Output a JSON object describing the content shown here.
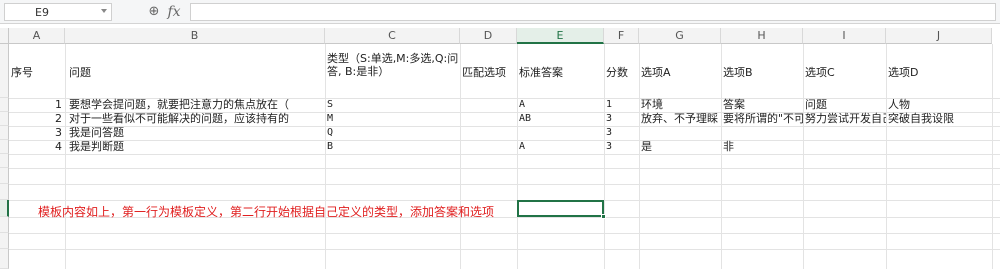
{
  "formula_bar": {
    "cell_ref": "E9",
    "fx_label": "fx",
    "formula_value": ""
  },
  "columns": [
    "A",
    "B",
    "C",
    "D",
    "E",
    "F",
    "G",
    "H",
    "I",
    "J"
  ],
  "selected_column": "E",
  "header_row": {
    "seq": "序号",
    "question": "问题",
    "type": "类型（S:单选,M:多选,Q:问答, B:是非）",
    "match": "匹配选项",
    "answer": "标准答案",
    "score": "分数",
    "optA": "选项A",
    "optB": "选项B",
    "optC": "选项C",
    "optD": "选项D"
  },
  "rows": [
    {
      "seq": "1",
      "question": "要想学会提问题，就要把注意力的焦点放在（",
      "type": "S",
      "answer": "A",
      "score": "1",
      "optA": "环境",
      "optB": "答案",
      "optC": "问题",
      "optD": "人物"
    },
    {
      "seq": "2",
      "question": "对于一些看似不可能解决的问题，应该持有的",
      "type": "M",
      "answer": "AB",
      "score": "3",
      "optA": "放弃、不予理睬",
      "optB": "要将所谓的\"不可能\"",
      "optC": "努力尝试开发自己",
      "optD": "突破自我设限"
    },
    {
      "seq": "3",
      "question": "我是问答题",
      "type": "Q",
      "answer": "",
      "score": "3",
      "optA": "",
      "optB": "",
      "optC": "",
      "optD": ""
    },
    {
      "seq": "4",
      "question": "我是判断题",
      "type": "B",
      "answer": "A",
      "score": "3",
      "optA": "是",
      "optB": "非",
      "optC": "",
      "optD": ""
    }
  ],
  "note": "模板内容如上，第一行为模板定义，第二行开始根据自己定义的类型，添加答案和选项",
  "colors": {
    "accent": "#217346",
    "note_text": "#e02020"
  }
}
